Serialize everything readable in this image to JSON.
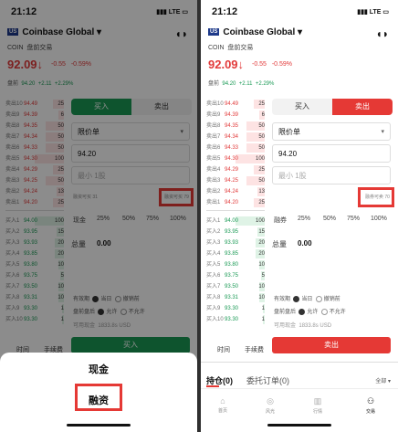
{
  "status": {
    "time": "21:12",
    "network": "LTE"
  },
  "stock": {
    "market": "US",
    "title": "Coinbase Global",
    "code": "COIN",
    "tag": "盘前交易",
    "price": "92.09",
    "change": "-0.55",
    "change_pct": "-0.59%",
    "pre_label": "盘前",
    "pre_price": "94.20",
    "pre_change": "+2.11",
    "pre_change_pct": "+2.29%"
  },
  "book": {
    "asks": [
      {
        "label": "卖出10",
        "price": "94.49",
        "vol": "25"
      },
      {
        "label": "卖出9",
        "price": "94.39",
        "vol": "6"
      },
      {
        "label": "卖出8",
        "price": "94.35",
        "vol": "50"
      },
      {
        "label": "卖出7",
        "price": "94.34",
        "vol": "50"
      },
      {
        "label": "卖出6",
        "price": "94.33",
        "vol": "50"
      },
      {
        "label": "卖出5",
        "price": "94.30",
        "vol": "100"
      },
      {
        "label": "卖出4",
        "price": "94.29",
        "vol": "25"
      },
      {
        "label": "卖出3",
        "price": "94.25",
        "vol": "50"
      },
      {
        "label": "卖出2",
        "price": "94.24",
        "vol": "13"
      },
      {
        "label": "卖出1",
        "price": "94.20",
        "vol": "25"
      }
    ],
    "bids": [
      {
        "label": "买入1",
        "price": "94.00",
        "vol": "100"
      },
      {
        "label": "买入2",
        "price": "93.95",
        "vol": "15"
      },
      {
        "label": "买入3",
        "price": "93.93",
        "vol": "20"
      },
      {
        "label": "买入4",
        "price": "93.85",
        "vol": "20"
      },
      {
        "label": "买入5",
        "price": "93.80",
        "vol": "10"
      },
      {
        "label": "买入6",
        "price": "93.75",
        "vol": "5"
      },
      {
        "label": "买入7",
        "price": "93.50",
        "vol": "10"
      },
      {
        "label": "买入8",
        "price": "93.31",
        "vol": "10"
      },
      {
        "label": "买入9",
        "price": "93.30",
        "vol": "1"
      },
      {
        "label": "买入10",
        "price": "93.30",
        "vol": "1"
      }
    ],
    "ask_bar_fracs": [
      0.3,
      0.15,
      0.5,
      0.5,
      0.5,
      0.8,
      0.3,
      0.5,
      0.2,
      0.3
    ],
    "bid_bar_fracs": [
      0.8,
      0.2,
      0.25,
      0.25,
      0.15,
      0.1,
      0.15,
      0.15,
      0.05,
      0.05
    ]
  },
  "form": {
    "buy_tab": "买入",
    "sell_tab": "卖出",
    "order_type": "限价单",
    "price_value": "94.20",
    "qty_placeholder": "最小 1股",
    "left_info_label": "融资可买 31",
    "left_info_right": "融资可买 79",
    "right_info": "融券可卖 70",
    "cash_label": "现金",
    "short_label": "融券",
    "pcts": [
      "25%",
      "50%",
      "75%",
      "100%"
    ],
    "total_label": "总量",
    "total_value": "0.00",
    "valid_label": "有效期",
    "valid_opt1": "当日",
    "valid_opt2": "撤销前",
    "ext_label": "盘前盘后",
    "ext_opt1": "允许",
    "ext_opt2": "不允许",
    "avail_label": "可用现金",
    "avail_value": "1833.8s USD",
    "buy_button": "买入",
    "sell_button": "卖出",
    "tab_time": "时间",
    "tab_fee": "手续费"
  },
  "sheet": {
    "cash": "现金",
    "margin": "融资"
  },
  "bottom": {
    "positions": "持仓(0)",
    "orders": "委托订单(0)",
    "filter": "全部",
    "nav": [
      {
        "label": "首页",
        "icon": "home-icon"
      },
      {
        "label": "风光",
        "icon": "discover-icon"
      },
      {
        "label": "行情",
        "icon": "market-icon"
      },
      {
        "label": "交易",
        "icon": "trade-icon"
      }
    ]
  },
  "colors": {
    "buy": "#1a9a55",
    "sell": "#e53935",
    "highlight": "#e53935"
  }
}
